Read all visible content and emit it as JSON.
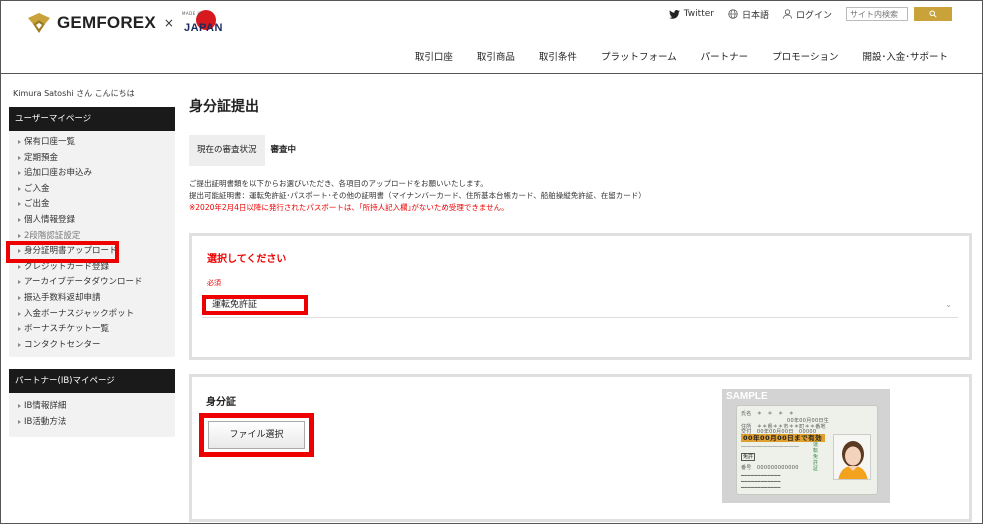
{
  "header": {
    "logo_text": "GEMFOREX",
    "logo_x": "×",
    "partner_logo_small": "MADE IN",
    "partner_logo_text": "JAPAN",
    "top_links": {
      "twitter": "Twitter",
      "language": "日本語",
      "login": "ログイン"
    },
    "search": {
      "placeholder": "サイト内検索"
    },
    "nav": [
      "取引口座",
      "取引商品",
      "取引条件",
      "プラットフォーム",
      "パートナー",
      "プロモーション",
      "開設･入金･サポート"
    ]
  },
  "sidebar": {
    "greeting": "Kimura Satoshi さん こんにちは",
    "section1_title": "ユーザーマイページ",
    "items": [
      "保有口座一覧",
      "定期預金",
      "追加口座お申込み",
      "ご入金",
      "ご出金",
      "個人情報登録",
      "2段階認証設定",
      "身分証明書アップロード",
      "クレジットカード登録",
      "アーカイブデータダウンロード",
      "振込手数料返却申請",
      "入金ボーナスジャックポット",
      "ボーナスチケット一覧",
      "コンタクトセンター"
    ],
    "section2_title": "パートナー(IB)マイページ",
    "items2": [
      "IB情報詳細",
      "IB活動方法"
    ]
  },
  "main": {
    "title": "身分証提出",
    "status_label": "現在の審査状況",
    "status_value": "審査中",
    "info_line1": "ご提出証明書類を以下からお選びいただき、各項目のアップロードをお願いいたします。",
    "info_line2": "提出可能証明書：運転免許証･パスポート･その他の証明書（マイナンバーカード、住所基本台帳カード、船舶操縦免許証、在留カード）",
    "info_warning": "※2020年2月4日以降に発行されたパスポートは、｢所持人記入欄｣がないため受理できません。",
    "select_title": "選択してください",
    "required_label": "必須",
    "selected_document": "運転免許証",
    "upload_title": "身分証",
    "file_button": "ファイル選択",
    "sample_label": "SAMPLE",
    "card": {
      "name": "氏名　＊　＊　＊　＊",
      "birth": "00年00月00日生",
      "address": "住所　＊＊県＊＊市＊＊町＊＊番地",
      "issued": "交付　00年00月00日　00000",
      "expire": "00年00月00日まで有効",
      "kind": "免許",
      "number": "番号　000000000000",
      "vertical": "運転免許証"
    }
  },
  "colors": {
    "accent_red": "#e00000",
    "gold": "#c9a33a",
    "sidebar_dark": "#1a1a1a"
  }
}
